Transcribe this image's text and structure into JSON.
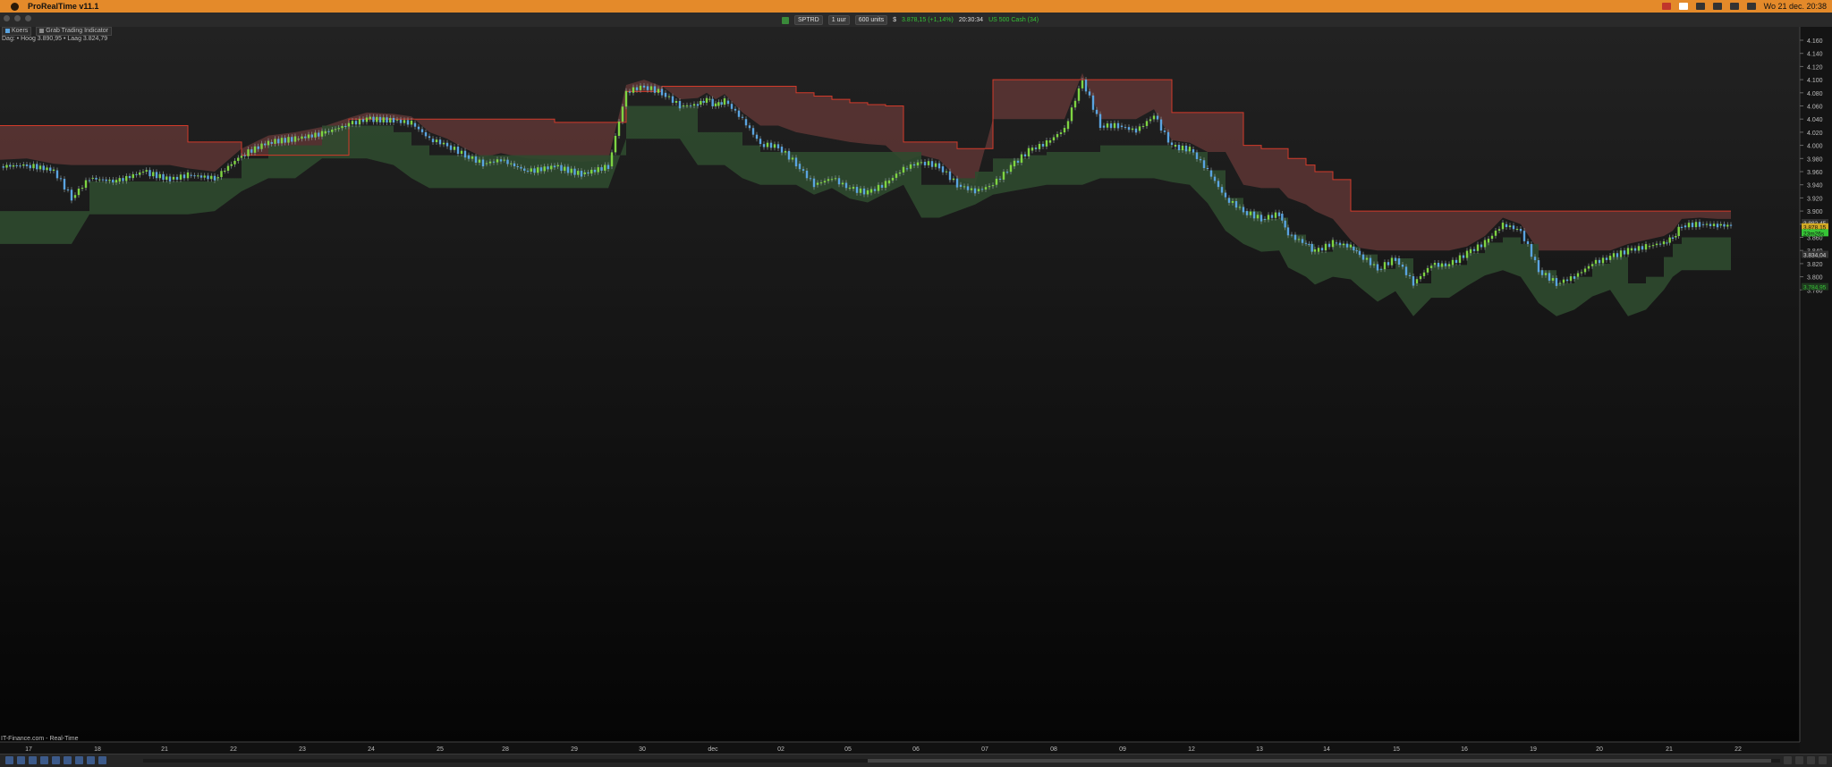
{
  "menubar": {
    "app_name": "ProRealTime v11.1",
    "datetime": "Wo 21 dec. 20:38",
    "accent": "#e48a2a"
  },
  "toolbar": {
    "symbol": "SPTRD",
    "interval": "1 uur",
    "units": "600 units",
    "currency": "$",
    "price": "3.878,15 (+1,14%)",
    "time": "20:30:34",
    "instrument": "US 500 Cash (34)"
  },
  "legend": {
    "koers_label": "Koers",
    "indicator_label": "Grab Trading Indicator",
    "info": "Dag: • Hoog 3.890,95 • Laag 3.824,79"
  },
  "footer": {
    "source": "IT-Finance.com - Real-Time"
  },
  "y_ticks": [
    "4.160",
    "4.140",
    "4.120",
    "4.100",
    "4.080",
    "4.060",
    "4.040",
    "4.020",
    "4.000",
    "3.980",
    "3.960",
    "3.940",
    "3.920",
    "3.900",
    "3.880",
    "3.860",
    "3.840",
    "3.820",
    "3.800",
    "3.780"
  ],
  "price_tags": {
    "high": "3.882,45",
    "last": "3.878,15",
    "countdown": "23m26s",
    "mid": "3.834,04",
    "low": "3.784,95"
  },
  "x_ticks": [
    "17",
    "18",
    "21",
    "22",
    "23",
    "24",
    "25",
    "28",
    "29",
    "30",
    "dec",
    "02",
    "05",
    "06",
    "07",
    "08",
    "09",
    "12",
    "13",
    "14",
    "15",
    "16",
    "19",
    "20",
    "21",
    "22"
  ],
  "colors": {
    "bull": "#7ed442",
    "bear": "#5aa4e0",
    "red_band": "#5a3433",
    "green_band": "#2f4a2f",
    "red_line": "#d23a2a",
    "green_line": "#36c436",
    "yellow_line": "#d1a824"
  },
  "chart_data": {
    "type": "line",
    "title": "",
    "series": [
      {
        "name": "Koers",
        "x": [
          0,
          30,
          60,
          80,
          100,
          130,
          160,
          190,
          210,
          240,
          270,
          300,
          330,
          360,
          390,
          410,
          440,
          460,
          480,
          500,
          520,
          540,
          560,
          590,
          620,
          650,
          680,
          700,
          720,
          740,
          760,
          780,
          790,
          800,
          810,
          830,
          850,
          870,
          890,
          910,
          930,
          950,
          970,
          990,
          1010,
          1030,
          1050,
          1070,
          1090,
          1110,
          1130,
          1150,
          1170,
          1190,
          1210,
          1230,
          1250,
          1270,
          1290,
          1310,
          1330,
          1350,
          1370,
          1390,
          1410,
          1430,
          1440,
          1460,
          1470,
          1490,
          1510,
          1520,
          1540,
          1560,
          1580,
          1600,
          1620,
          1640,
          1660,
          1680,
          1700,
          1720,
          1740,
          1760,
          1780,
          1800,
          1820,
          1840,
          1860,
          1870,
          1880,
          1900,
          1920,
          1935
        ],
        "y": [
          3968,
          3970,
          3962,
          3920,
          3950,
          3945,
          3960,
          3948,
          3955,
          3950,
          3985,
          4005,
          4010,
          4018,
          4032,
          4040,
          4038,
          4034,
          4010,
          4000,
          3985,
          3972,
          3978,
          3960,
          3968,
          3956,
          3968,
          4082,
          4090,
          4080,
          4060,
          4062,
          4070,
          4060,
          4068,
          4040,
          4002,
          3998,
          3972,
          3940,
          3950,
          3934,
          3928,
          3942,
          3965,
          3975,
          3968,
          3940,
          3930,
          3940,
          3968,
          3992,
          4004,
          4025,
          4100,
          4030,
          4030,
          4022,
          4045,
          3998,
          3994,
          3962,
          3920,
          3900,
          3888,
          3896,
          3864,
          3850,
          3838,
          3852,
          3846,
          3834,
          3812,
          3828,
          3790,
          3818,
          3818,
          3836,
          3852,
          3880,
          3870,
          3810,
          3790,
          3800,
          3820,
          3830,
          3840,
          3846,
          3852,
          3860,
          3878,
          3880,
          3878,
          3878
        ]
      }
    ],
    "red_band_upper": [
      4030,
      4030,
      4030,
      4030,
      4030,
      4030,
      4030,
      4030,
      4005,
      4005,
      3985,
      3985,
      3985,
      3985,
      4040,
      4040,
      4040,
      4040,
      4040,
      4040,
      4040,
      4040,
      4040,
      4040,
      4035,
      4035,
      4035,
      4082,
      4082,
      4090,
      4090,
      4090,
      4090,
      4090,
      4090,
      4090,
      4090,
      4090,
      4080,
      4075,
      4070,
      4065,
      4062,
      4060,
      4005,
      4005,
      4005,
      3995,
      3995,
      4100,
      4100,
      4100,
      4100,
      4100,
      4100,
      4100,
      4100,
      4100,
      4100,
      4050,
      4050,
      4050,
      4050,
      4000,
      3995,
      3995,
      3980,
      3970,
      3960,
      3948,
      3900,
      3900,
      3900,
      3900,
      3900,
      3900,
      3900,
      3900,
      3900,
      3900,
      3900,
      3900,
      3900,
      3900,
      3900,
      3900,
      3900,
      3900,
      3900,
      3900,
      3900,
      3900,
      3900,
      3900
    ],
    "green_band_upper": [
      3900,
      3900,
      3900,
      3900,
      3945,
      3945,
      3945,
      3945,
      3945,
      3950,
      3980,
      4000,
      4000,
      4030,
      4030,
      4030,
      4020,
      4000,
      3985,
      3985,
      3985,
      3985,
      3985,
      3985,
      3985,
      3985,
      3985,
      4060,
      4060,
      4060,
      4060,
      4020,
      4020,
      4020,
      4020,
      4000,
      3990,
      3990,
      3990,
      3990,
      3990,
      3990,
      3990,
      3990,
      3990,
      3940,
      3940,
      3950,
      3960,
      3980,
      3980,
      3985,
      3990,
      3990,
      3990,
      4000,
      4000,
      4000,
      4000,
      3994,
      3990,
      3962,
      3920,
      3900,
      3888,
      3890,
      3864,
      3850,
      3838,
      3850,
      3846,
      3834,
      3812,
      3828,
      3790,
      3818,
      3818,
      3836,
      3852,
      3860,
      3850,
      3810,
      3790,
      3800,
      3820,
      3830,
      3790,
      3800,
      3830,
      3850,
      3860,
      3860,
      3860,
      3860
    ]
  }
}
